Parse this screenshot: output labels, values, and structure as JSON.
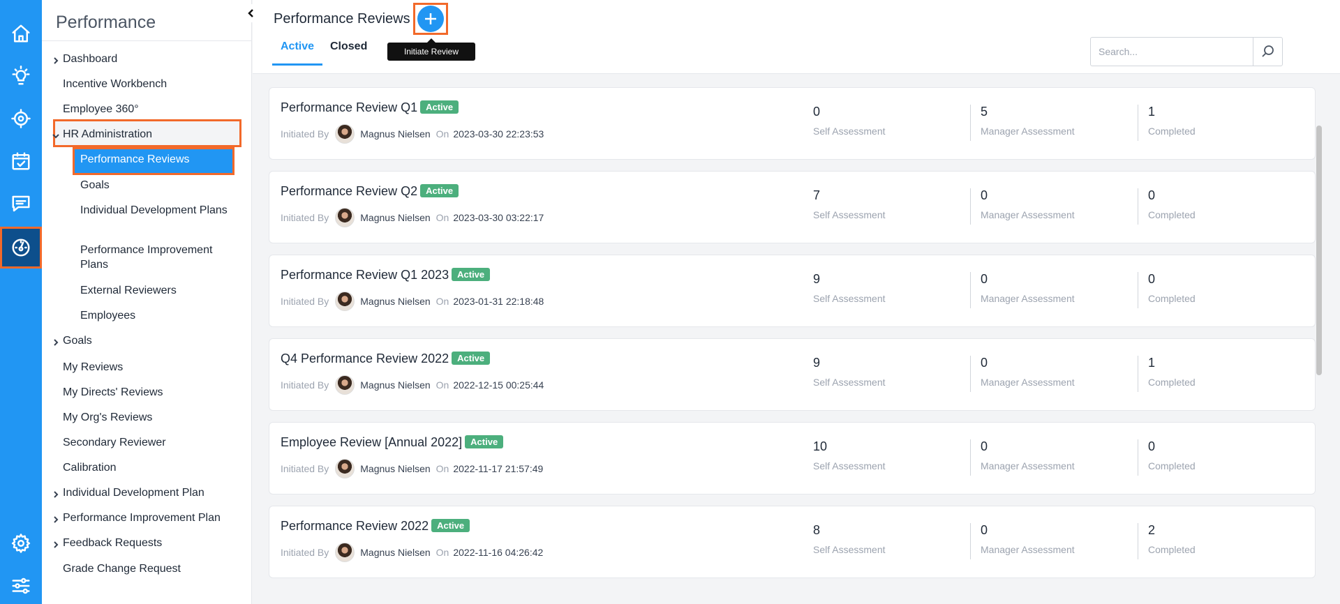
{
  "rail": {
    "icons": [
      "home-icon",
      "lightbulb-icon",
      "target-icon",
      "calendar-check-icon",
      "chat-icon",
      "gauge-icon",
      "settings-icon",
      "sliders-icon"
    ]
  },
  "sidebar": {
    "title": "Performance",
    "items": [
      {
        "label": "Dashboard",
        "expandable": true
      },
      {
        "label": "Incentive Workbench"
      },
      {
        "label": "Employee 360°"
      },
      {
        "label": "HR Administration",
        "expanded": true
      },
      {
        "label": "Performance Reviews",
        "active": true
      },
      {
        "label": "Goals"
      },
      {
        "label": "Individual Development Plans"
      },
      {
        "label": "Performance Improvement Plans"
      },
      {
        "label": "External Reviewers"
      },
      {
        "label": "Employees"
      },
      {
        "label": "Goals",
        "expandable": true
      },
      {
        "label": "My Reviews"
      },
      {
        "label": "My Directs' Reviews"
      },
      {
        "label": "My Org's Reviews"
      },
      {
        "label": "Secondary Reviewer"
      },
      {
        "label": "Calibration"
      },
      {
        "label": "Individual Development Plan",
        "expandable": true
      },
      {
        "label": "Performance Improvement Plan",
        "expandable": true
      },
      {
        "label": "Feedback Requests",
        "expandable": true
      },
      {
        "label": "Grade Change Request"
      }
    ]
  },
  "header": {
    "title": "Performance Reviews",
    "tooltip": "Initiate Review",
    "tabs": [
      {
        "label": "Active"
      },
      {
        "label": "Closed"
      }
    ],
    "search_placeholder": "Search..."
  },
  "reviews": [
    {
      "title": "Performance Review Q1",
      "status": "Active",
      "initiated_by_label": "Initiated By",
      "initiator": "Magnus Nielsen",
      "on_label": "On",
      "date": "2023-03-30 22:23:53",
      "self": "0",
      "manager": "5",
      "completed": "1"
    },
    {
      "title": "Performance Review Q2",
      "status": "Active",
      "initiated_by_label": "Initiated By",
      "initiator": "Magnus Nielsen",
      "on_label": "On",
      "date": "2023-03-30 03:22:17",
      "self": "7",
      "manager": "0",
      "completed": "0"
    },
    {
      "title": "Performance Review Q1 2023",
      "status": "Active",
      "initiated_by_label": "Initiated By",
      "initiator": "Magnus Nielsen",
      "on_label": "On",
      "date": "2023-01-31 22:18:48",
      "self": "9",
      "manager": "0",
      "completed": "0"
    },
    {
      "title": "Q4 Performance Review 2022",
      "status": "Active",
      "initiated_by_label": "Initiated By",
      "initiator": "Magnus Nielsen",
      "on_label": "On",
      "date": "2022-12-15 00:25:44",
      "self": "9",
      "manager": "0",
      "completed": "1"
    },
    {
      "title": "Employee Review [Annual 2022]",
      "status": "Active",
      "initiated_by_label": "Initiated By",
      "initiator": "Magnus Nielsen",
      "on_label": "On",
      "date": "2022-11-17 21:57:49",
      "self": "10",
      "manager": "0",
      "completed": "0"
    },
    {
      "title": "Performance Review 2022",
      "status": "Active",
      "initiated_by_label": "Initiated By",
      "initiator": "Magnus Nielsen",
      "on_label": "On",
      "date": "2022-11-16 04:26:42",
      "self": "8",
      "manager": "0",
      "completed": "2"
    }
  ],
  "stat_labels": {
    "self": "Self Assessment",
    "manager": "Manager Assessment",
    "completed": "Completed"
  },
  "colors": {
    "primary": "#2196f3",
    "highlight": "#f2692a",
    "badge": "#4caf7d"
  }
}
